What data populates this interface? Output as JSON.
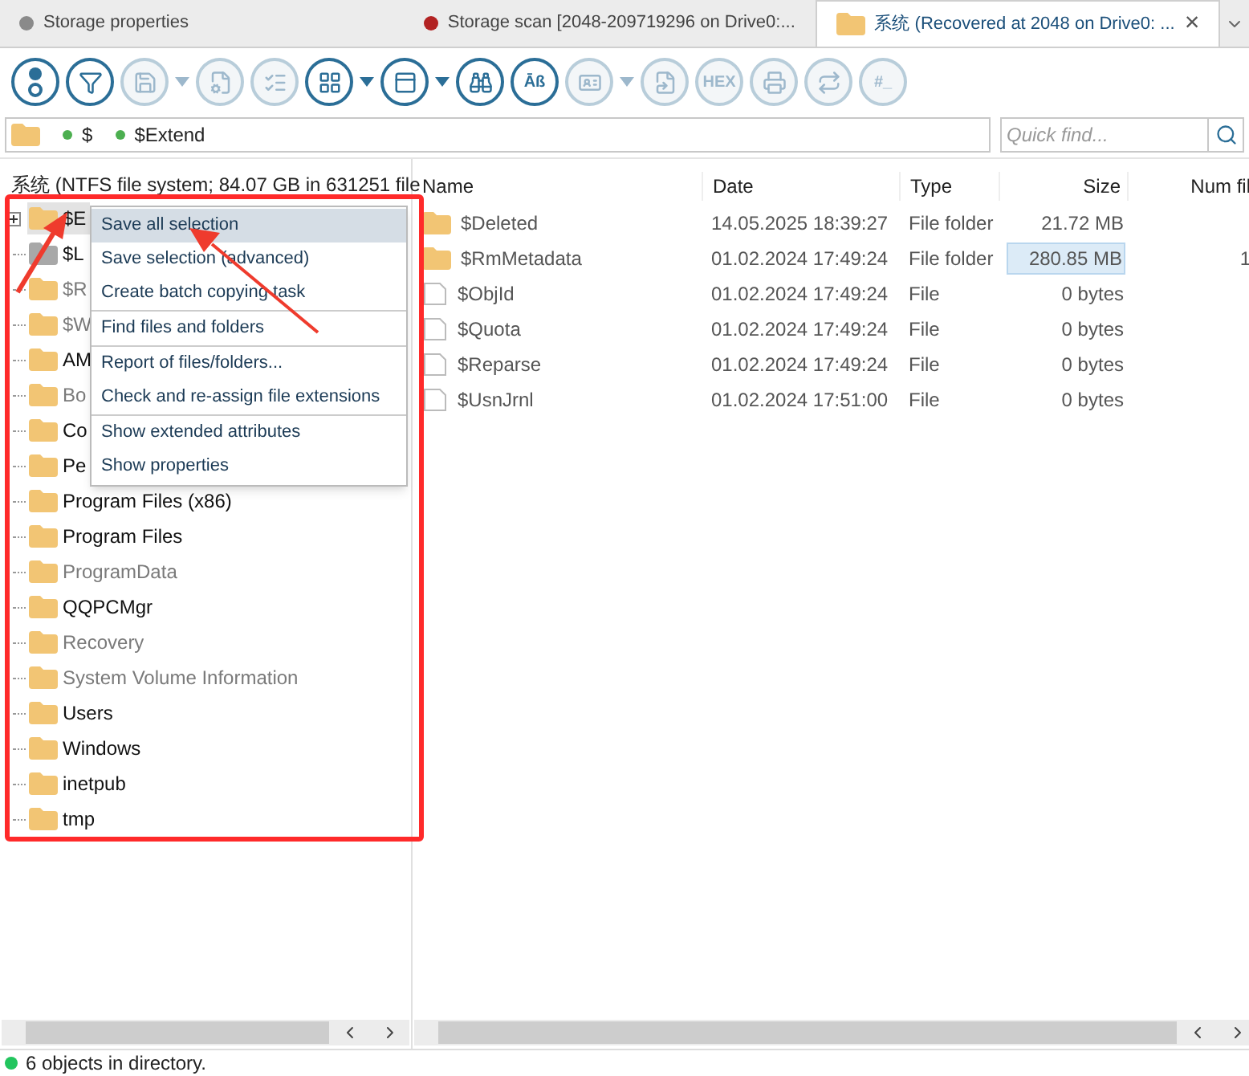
{
  "tabs": [
    {
      "label": "Storage properties",
      "color": "#8a8a8a",
      "selected": false
    },
    {
      "label": "Storage scan [2048-209719296 on Drive0:...",
      "color": "#b22222",
      "selected": false
    },
    {
      "label": "系统 (Recovered at 2048 on Drive0: ...",
      "selected": true,
      "close": "×"
    }
  ],
  "toolbar": [
    {
      "disabled": false,
      "dropdown": false
    },
    {
      "disabled": false,
      "dropdown": false
    },
    {
      "disabled": true,
      "dropdown": true
    },
    {
      "disabled": true,
      "dropdown": false
    },
    {
      "disabled": true,
      "dropdown": false
    },
    {
      "disabled": false,
      "dropdown": true
    },
    {
      "disabled": false,
      "dropdown": true
    },
    {
      "disabled": false,
      "dropdown": false
    },
    {
      "disabled": false,
      "dropdown": false,
      "label": "Āß"
    },
    {
      "disabled": true,
      "dropdown": true
    },
    {
      "disabled": true,
      "dropdown": false
    },
    {
      "disabled": true,
      "dropdown": false,
      "label": "HEX"
    },
    {
      "disabled": true,
      "dropdown": false
    },
    {
      "disabled": true,
      "dropdown": false
    },
    {
      "disabled": true,
      "dropdown": false,
      "label": "#_"
    }
  ],
  "path": [
    "$",
    "$Extend"
  ],
  "search": {
    "placeholder": "Quick find..."
  },
  "tree": {
    "root": "系统 (NTFS file system; 84.07 GB in 631251 file",
    "items": [
      {
        "label": "$E",
        "dimmed": false,
        "selected": true,
        "expandable": true
      },
      {
        "label": "$L",
        "dimmed": false,
        "selected": false,
        "expandable": false,
        "grey_icon": true
      },
      {
        "label": "$R",
        "dimmed": true,
        "selected": false,
        "expandable": false
      },
      {
        "label": "$W",
        "dimmed": true,
        "selected": false,
        "expandable": false
      },
      {
        "label": "AM",
        "dimmed": false,
        "selected": false,
        "expandable": false
      },
      {
        "label": "Bo",
        "dimmed": true,
        "selected": false,
        "expandable": false
      },
      {
        "label": "Co",
        "dimmed": false,
        "selected": false,
        "expandable": false
      },
      {
        "label": "Pe",
        "dimmed": false,
        "selected": false,
        "expandable": false
      },
      {
        "label": "Program Files (x86)",
        "dimmed": false,
        "selected": false,
        "expandable": false
      },
      {
        "label": "Program Files",
        "dimmed": false,
        "selected": false,
        "expandable": false
      },
      {
        "label": "ProgramData",
        "dimmed": true,
        "selected": false,
        "expandable": false
      },
      {
        "label": "QQPCMgr",
        "dimmed": false,
        "selected": false,
        "expandable": false
      },
      {
        "label": "Recovery",
        "dimmed": true,
        "selected": false,
        "expandable": false
      },
      {
        "label": "System Volume Information",
        "dimmed": true,
        "selected": false,
        "expandable": false
      },
      {
        "label": "Users",
        "dimmed": false,
        "selected": false,
        "expandable": false
      },
      {
        "label": "Windows",
        "dimmed": false,
        "selected": false,
        "expandable": false
      },
      {
        "label": "inetpub",
        "dimmed": false,
        "selected": false,
        "expandable": false
      },
      {
        "label": "tmp",
        "dimmed": false,
        "selected": false,
        "expandable": false
      }
    ]
  },
  "context_menu": {
    "groups": [
      [
        {
          "label": "Save all selection",
          "selected": true
        },
        {
          "label": "Save selection (advanced)",
          "selected": false
        },
        {
          "label": "Create batch copying task",
          "selected": false
        }
      ],
      [
        {
          "label": "Find files and folders",
          "selected": false
        }
      ],
      [
        {
          "label": "Report of files/folders...",
          "selected": false
        },
        {
          "label": "Check and re-assign file extensions",
          "selected": false
        }
      ],
      [
        {
          "label": "Show extended attributes",
          "selected": false
        },
        {
          "label": "Show properties",
          "selected": false
        }
      ]
    ]
  },
  "table": {
    "columns": [
      "Name",
      "Date",
      "Type",
      "Size",
      "Num fil"
    ],
    "rows": [
      {
        "kind": "folder",
        "name": "$Deleted",
        "date": "14.05.2025 18:39:27",
        "type": "File folder",
        "size": "21.72 MB",
        "highlighted": false
      },
      {
        "kind": "folder",
        "name": "$RmMetadata",
        "date": "01.02.2024 17:49:24",
        "type": "File folder",
        "size": "280.85 MB",
        "count": "1",
        "highlighted": true
      },
      {
        "kind": "file",
        "name": "$ObjId",
        "date": "01.02.2024 17:49:24",
        "type": "File",
        "size": "0 bytes",
        "highlighted": false
      },
      {
        "kind": "file",
        "name": "$Quota",
        "date": "01.02.2024 17:49:24",
        "type": "File",
        "size": "0 bytes",
        "highlighted": false
      },
      {
        "kind": "file",
        "name": "$Reparse",
        "date": "01.02.2024 17:49:24",
        "type": "File",
        "size": "0 bytes",
        "highlighted": false
      },
      {
        "kind": "file",
        "name": "$UsnJrnl",
        "date": "01.02.2024 17:51:00",
        "type": "File",
        "size": "0 bytes",
        "highlighted": false
      }
    ]
  },
  "status": {
    "text": "6 objects in directory.",
    "color": "#22c55e"
  }
}
